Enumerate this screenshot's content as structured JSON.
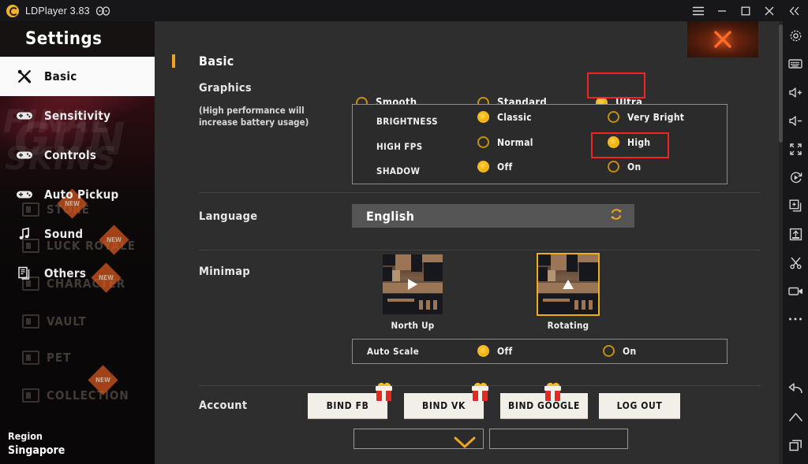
{
  "titlebar": {
    "app_name": "LDPlayer 3.83",
    "logo_icon": "ldplayer-logo-icon",
    "gamepad_icon": "gamepad-icon",
    "buttons": [
      {
        "name": "menu-button",
        "icon": "hamburger-menu-icon"
      },
      {
        "name": "minimize-button",
        "icon": "minimize-icon"
      },
      {
        "name": "maximize-button",
        "icon": "maximize-icon"
      },
      {
        "name": "close-button",
        "icon": "close-x-icon"
      },
      {
        "name": "collapse-toolbar-button",
        "icon": "double-chevron-left-icon"
      }
    ]
  },
  "game_sidebar": {
    "header_title": "Settings",
    "items": [
      {
        "label": "Basic",
        "icon": "tools-icon",
        "active": true
      },
      {
        "label": "Sensitivity",
        "icon": "gamepad-icon",
        "active": false
      },
      {
        "label": "Controls",
        "icon": "gamepad-icon",
        "active": false
      },
      {
        "label": "Auto Pickup",
        "icon": "gamepad-icon",
        "active": false
      },
      {
        "label": "Sound",
        "icon": "music-note-icon",
        "active": false
      },
      {
        "label": "Others",
        "icon": "document-copy-icon",
        "active": false
      }
    ],
    "background_menu": [
      {
        "label": "STORE",
        "badge": ""
      },
      {
        "label": "LUCK ROYALE",
        "badge": "NEW"
      },
      {
        "label": "CHARACTER",
        "badge": "NEW"
      },
      {
        "label": "VAULT",
        "badge": ""
      },
      {
        "label": "PET",
        "badge": ""
      },
      {
        "label": "COLLECTION",
        "badge": "NEW"
      }
    ],
    "background_art_words": [
      "FINAL",
      "GUN",
      "SKINS"
    ],
    "region_label": "Region",
    "region_value": "Singapore"
  },
  "panel": {
    "close_icon": "close-x-icon",
    "section_title": "Basic",
    "graphics": {
      "label": "Graphics",
      "note": "(High performance will increase battery usage)",
      "options": [
        {
          "label": "Smooth",
          "selected": false
        },
        {
          "label": "Standard",
          "selected": false
        },
        {
          "label": "Ultra",
          "selected": true,
          "highlighted": true
        }
      ],
      "detail_rows": [
        {
          "label": "BRIGHTNESS",
          "options": [
            {
              "label": "Classic",
              "selected": true,
              "highlighted": false
            },
            {
              "label": "Very Bright",
              "selected": false,
              "highlighted": false
            }
          ]
        },
        {
          "label": "HIGH FPS",
          "options": [
            {
              "label": "Normal",
              "selected": false,
              "highlighted": false
            },
            {
              "label": "High",
              "selected": true,
              "highlighted": true
            }
          ]
        },
        {
          "label": "SHADOW",
          "options": [
            {
              "label": "Off",
              "selected": true,
              "highlighted": false
            },
            {
              "label": "On",
              "selected": false,
              "highlighted": false
            }
          ]
        }
      ]
    },
    "language": {
      "label": "Language",
      "value": "English",
      "refresh_icon": "refresh-icon"
    },
    "minimap": {
      "label": "Minimap",
      "options": [
        {
          "caption": "North Up",
          "selected": false
        },
        {
          "caption": "Rotating",
          "selected": true
        }
      ],
      "auto_scale": {
        "label": "Auto Scale",
        "options": [
          {
            "label": "Off",
            "selected": true
          },
          {
            "label": "On",
            "selected": false
          }
        ]
      }
    },
    "account": {
      "label": "Account",
      "buttons": [
        {
          "label": "BIND FB",
          "gift": true
        },
        {
          "label": "BIND VK",
          "gift": true
        },
        {
          "label": "BIND GOOGLE",
          "gift": true
        },
        {
          "label": "LOG OUT",
          "gift": false
        }
      ]
    },
    "scroll_down_icon": "chevron-down-icon"
  },
  "right_toolbar": {
    "top_icons": [
      {
        "name": "settings-gear-icon"
      },
      {
        "name": "keyboard-icon"
      },
      {
        "name": "volume-up-icon"
      },
      {
        "name": "volume-down-icon"
      },
      {
        "name": "fullscreen-icon"
      },
      {
        "name": "macro-record-icon"
      },
      {
        "name": "multi-instance-icon"
      },
      {
        "name": "install-apk-icon"
      },
      {
        "name": "scissors-screenshot-icon"
      },
      {
        "name": "video-record-icon"
      },
      {
        "name": "more-options-icon"
      }
    ],
    "bottom_icons": [
      {
        "name": "back-icon"
      },
      {
        "name": "home-icon"
      },
      {
        "name": "recents-icon"
      }
    ]
  }
}
